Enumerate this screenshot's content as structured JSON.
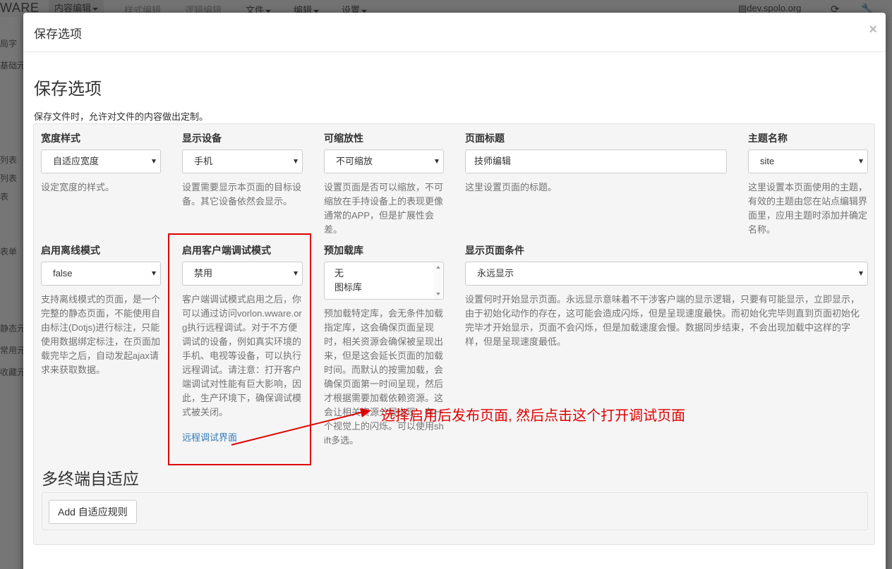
{
  "background": {
    "brand": "WARE",
    "menus": [
      {
        "label": "内容编辑",
        "state": "active"
      },
      {
        "label": "样式编辑",
        "state": "disabled"
      },
      {
        "label": "逻辑编辑",
        "state": "disabled"
      },
      {
        "label": "文件",
        "state": "normal"
      },
      {
        "label": "编辑",
        "state": "normal"
      },
      {
        "label": "设置",
        "state": "normal"
      }
    ],
    "site": "dev.spolo.org",
    "left_items": [
      "局字",
      "基础元",
      "列表",
      "列表",
      "表",
      "表单",
      "静态元",
      "常用元",
      "收藏元"
    ]
  },
  "modal": {
    "title": "保存选项",
    "close": "×",
    "heading": "保存选项",
    "description": "保存文件时，允许对文件的内容做出定制。",
    "fields": {
      "width_style": {
        "label": "宽度样式",
        "value": "自适应宽度",
        "help": "设定宽度的样式。"
      },
      "device": {
        "label": "显示设备",
        "value": "手机",
        "help": "设置需要显示本页面的目标设备。其它设备依然会显示。"
      },
      "scalable": {
        "label": "可缩放性",
        "value": "不可缩放",
        "help": "设置页面是否可以缩放，不可缩放在手持设备上的表现更像通常的APP，但是扩展性会差。"
      },
      "page_title": {
        "label": "页面标题",
        "value": "技师编辑",
        "help": "这里设置页面的标题。"
      },
      "theme": {
        "label": "主题名称",
        "value": "site",
        "help": "这里设置本页面使用的主题，有效的主题由您在站点编辑界面里，应用主题时添加并确定名称。"
      },
      "offline": {
        "label": "启用离线模式",
        "value": "false",
        "help": "支持离线模式的页面，是一个完整的静态页面，不能使用自由标注(Dotjs)进行标注，只能使用数据绑定标注，在页面加载完毕之后，自动发起ajax请求来获取数据。"
      },
      "client_debug": {
        "label": "启用客户端调试模式",
        "value": "禁用",
        "help": "客户端调试模式启用之后，你可以通过访问vorlon.wware.org执行远程调试。对于不方便调试的设备，例如真实环境的手机、电视等设备，可以执行远程调试。请注意：打开客户端调试对性能有巨大影响，因此，生产环境下，确保调试模式被关闭。",
        "link": "远程调试界面"
      },
      "preload": {
        "label": "预加载库",
        "options": [
          "无",
          "图标库"
        ],
        "help": "预加载特定库，会无条件加载指定库，这会确保页面呈现时，相关资源会确保被呈现出来，但是这会延长页面的加载时间。而默认的按需加载，会确保页面第一时间呈现，然后才根据需要加载依赖资源。这会让相关资源分层出现，有一个视觉上的闪烁。可以使用shift多选。"
      },
      "display_condition": {
        "label": "显示页面条件",
        "value": "永远显示",
        "help": "设置何时开始显示页面。永远显示意味着不干涉客户端的显示逻辑，只要有可能显示，立即显示，由于初始化动作的存在，这可能会造成闪烁，但是呈现速度最快。而初始化完毕则直到页面初始化完毕才开始显示，页面不会闪烁，但是加载速度会慢。数据同步结束，不会出现加载中这样的字样，但是呈现速度最低。"
      }
    },
    "multi_terminal": {
      "heading": "多终端自适应",
      "add_button": "Add 自适应规则"
    }
  },
  "annotation": {
    "text": "选择启用后发布页面, 然后点击这个打开调试页面",
    "color": "#e00000"
  }
}
